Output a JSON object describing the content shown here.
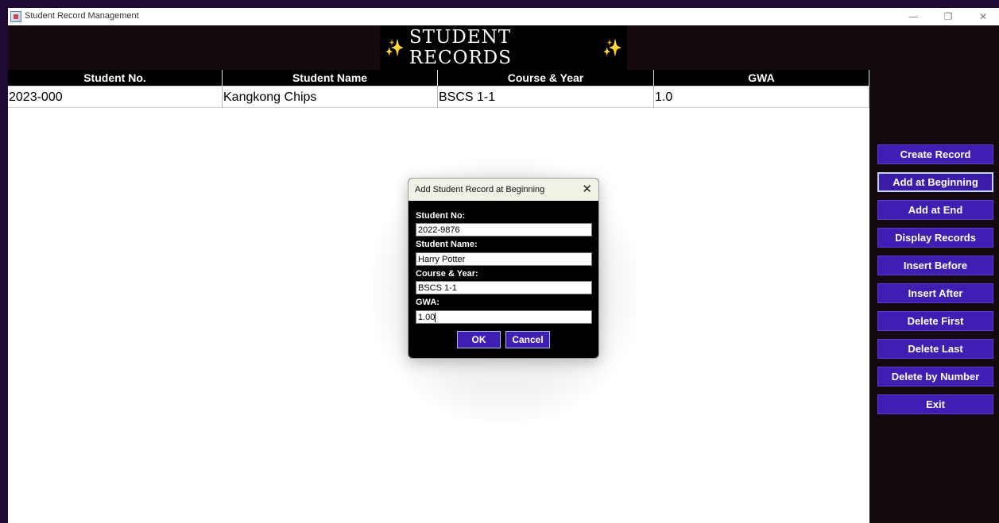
{
  "window": {
    "title": "Student Record Management",
    "controls": {
      "minimize": "—",
      "maximize": "❐",
      "close": "✕"
    }
  },
  "banner": {
    "star": "✨",
    "title": "STUDENT RECORDS"
  },
  "table": {
    "columns": [
      "Student No.",
      "Student Name",
      "Course & Year",
      "GWA"
    ],
    "rows": [
      [
        "2023-000",
        "Kangkong Chips",
        "BSCS 1-1",
        "1.0"
      ]
    ]
  },
  "dialog": {
    "title": "Add Student Record at Beginning",
    "close": "✕",
    "fields": [
      {
        "label": "Student No:",
        "value": "2022-9876"
      },
      {
        "label": "Student Name:",
        "value": "Harry Potter"
      },
      {
        "label": "Course & Year:",
        "value": "BSCS 1-1"
      },
      {
        "label": "GWA:",
        "value": "1.00"
      }
    ],
    "ok_label": "OK",
    "cancel_label": "Cancel"
  },
  "sidebar": {
    "buttons": [
      "Create Record",
      "Add at Beginning",
      "Add at End",
      "Display Records",
      "Insert Before",
      "Insert After",
      "Delete First",
      "Delete Last",
      "Delete by Number",
      "Exit"
    ],
    "active_index": 1
  },
  "colors": {
    "background": "#1e0a33",
    "accent_button": "#3f1eb4",
    "table_header": "#000000",
    "banner_star": "#e9c64a"
  }
}
